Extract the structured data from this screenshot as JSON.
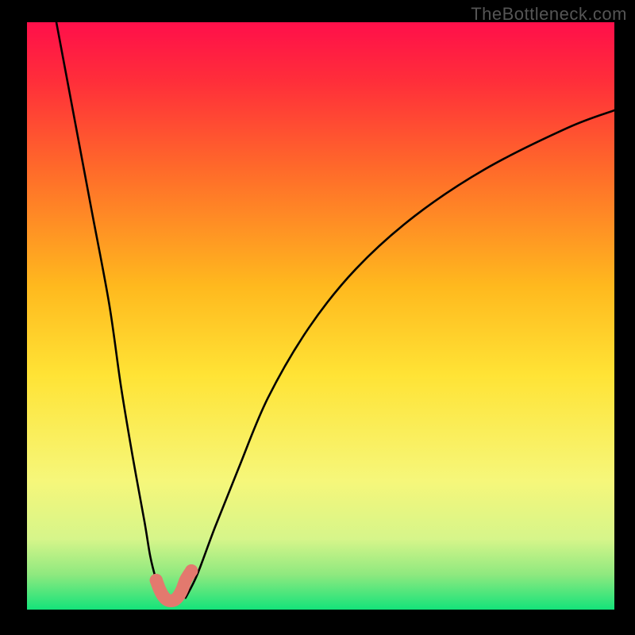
{
  "watermark": "TheBottleneck.com",
  "chart_data": {
    "type": "line",
    "title": "",
    "xlabel": "",
    "ylabel": "",
    "xlim": [
      0,
      100
    ],
    "ylim": [
      0,
      100
    ],
    "background_gradient": {
      "stops": [
        {
          "pos": 0.0,
          "color": "#ff0f4a"
        },
        {
          "pos": 0.1,
          "color": "#ff2e3a"
        },
        {
          "pos": 0.25,
          "color": "#ff6a2a"
        },
        {
          "pos": 0.45,
          "color": "#ffb91e"
        },
        {
          "pos": 0.6,
          "color": "#ffe335"
        },
        {
          "pos": 0.78,
          "color": "#f6f77a"
        },
        {
          "pos": 0.88,
          "color": "#d6f58a"
        },
        {
          "pos": 0.94,
          "color": "#8fe97f"
        },
        {
          "pos": 1.0,
          "color": "#14e37a"
        }
      ]
    },
    "series": [
      {
        "name": "curve-left",
        "color": "#000000",
        "x": [
          5,
          8,
          11,
          14,
          16,
          18,
          20,
          21,
          22,
          23
        ],
        "y": [
          100,
          84,
          68,
          52,
          38,
          26,
          15,
          9,
          5,
          2
        ]
      },
      {
        "name": "curve-right",
        "color": "#000000",
        "x": [
          27,
          29,
          32,
          36,
          41,
          48,
          56,
          66,
          78,
          92,
          100
        ],
        "y": [
          2,
          6,
          14,
          24,
          36,
          48,
          58,
          67,
          75,
          82,
          85
        ]
      },
      {
        "name": "highlight-bump",
        "color": "#e3796e",
        "thick": true,
        "x": [
          22.0,
          22.6,
          23.2,
          23.8,
          24.5,
          25.2,
          25.8,
          26.4,
          27.0,
          27.6,
          28.0
        ],
        "y": [
          5.0,
          3.4,
          2.3,
          1.7,
          1.5,
          1.7,
          2.3,
          3.4,
          5.0,
          6.0,
          6.6
        ]
      }
    ]
  }
}
